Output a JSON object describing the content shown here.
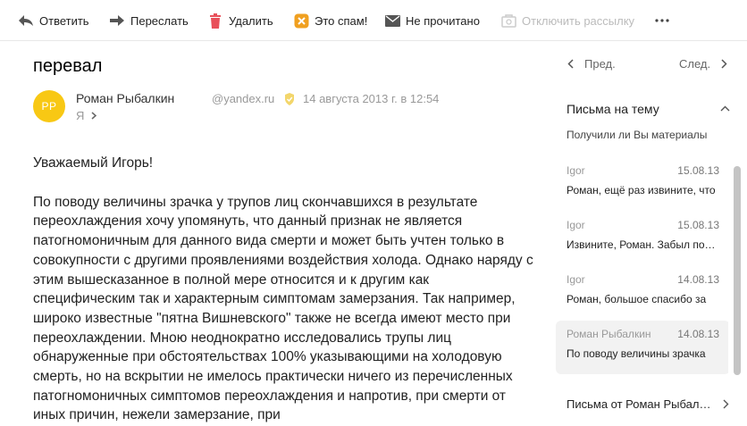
{
  "toolbar": {
    "reply": "Ответить",
    "forward": "Переслать",
    "delete": "Удалить",
    "spam": "Это спам!",
    "unread": "Не прочитано",
    "unsubscribe": "Отключить рассылку"
  },
  "message": {
    "subject": "перевал",
    "avatar_initials": "РР",
    "sender_name": "Роман Рыбалкин",
    "sender_email": "@yandex.ru",
    "date": "14 августа 2013 г. в 12:54",
    "recipient": "Я",
    "greeting": "Уважаемый Игорь!",
    "body": "По поводу величины зрачка у трупов лиц скончавшихся в результате переохлаждения хочу упомянуть, что данный признак не является патогномоничным для данного вида смерти и может быть учтен только в совокупности с другими проявлениями воздействия холода. Однако наряду с этим вышесказанное в полной мере относится и к другим как специфическим так и характерным симптомам замерзания. Так например, широко известные \"пятна Вишневского\" также не всегда имеют место при переохлаждении. Мною неоднократно исследовались трупы лиц обнаруженные при обстоятельствах 100% указывающими на холодовую смерть, но на вскрытии не имелось практически ничего из перечисленных патогномоничных симптомов переохлаждения и напротив, при смерти от иных причин, нежели замерзание, при"
  },
  "navigation": {
    "prev": "Пред.",
    "next": "След."
  },
  "thread": {
    "title": "Письма на тему",
    "partial_snippet": "Получили ли Вы материалы",
    "items": [
      {
        "from": "Igor",
        "date": "15.08.13",
        "snippet": "Роман, ещё раз извините, что"
      },
      {
        "from": "Igor",
        "date": "15.08.13",
        "snippet": "Извините, Роман. Забыл поблагодарить"
      },
      {
        "from": "Igor",
        "date": "14.08.13",
        "snippet": "Роман, большое спасибо за"
      },
      {
        "from": "Роман Рыбалкин",
        "date": "14.08.13",
        "snippet": "По поводу величины зрачка"
      }
    ]
  },
  "from_sender": "Письма от Роман Рыбалкин",
  "colors": {
    "avatar": "#f8c814",
    "accent_spam": "#f0a020",
    "delete_red": "#e8505a"
  }
}
